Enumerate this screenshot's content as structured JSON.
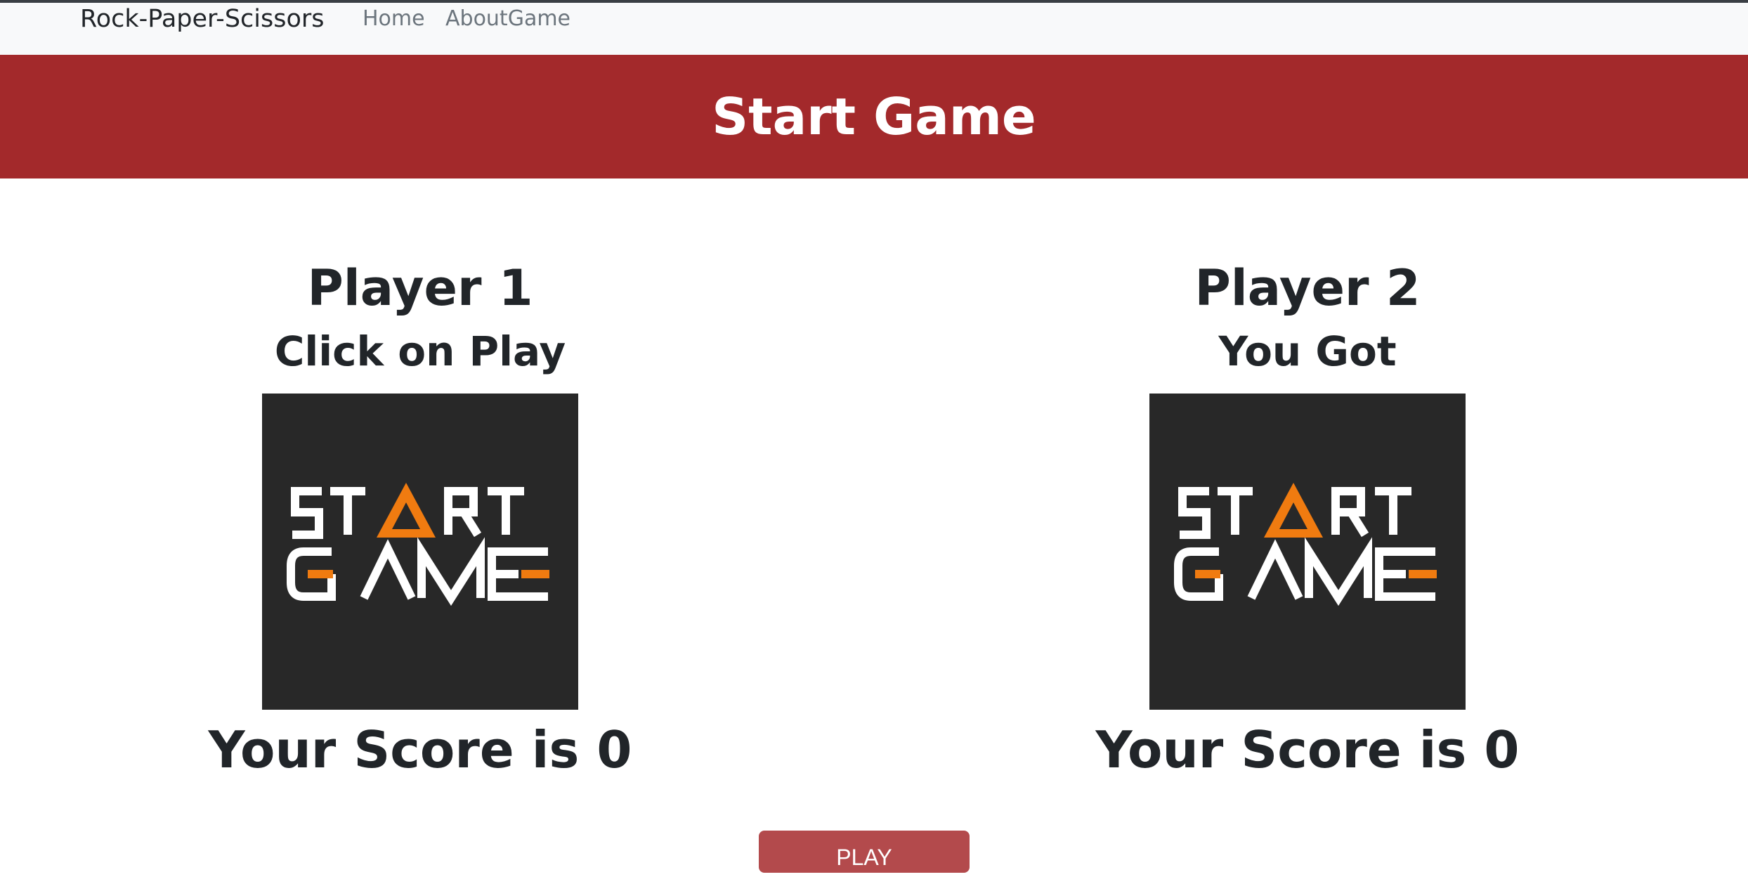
{
  "navbar": {
    "brand": "Rock-Paper-Scissors",
    "links": [
      "Home",
      "AboutGame"
    ]
  },
  "hero": {
    "title": "Start Game"
  },
  "players": [
    {
      "name": "Player 1",
      "status": "Click on Play",
      "image_text": "START GAME",
      "score_text": "Your Score is 0"
    },
    {
      "name": "Player 2",
      "status": "You Got",
      "image_text": "START GAME",
      "score_text": "Your Score is 0"
    }
  ],
  "play_button": {
    "label": "PLAY"
  },
  "colors": {
    "hero_bg": "#a3292b",
    "button_bg": "#b34a4c",
    "image_bg": "#282828",
    "image_accent": "#f07b10"
  }
}
